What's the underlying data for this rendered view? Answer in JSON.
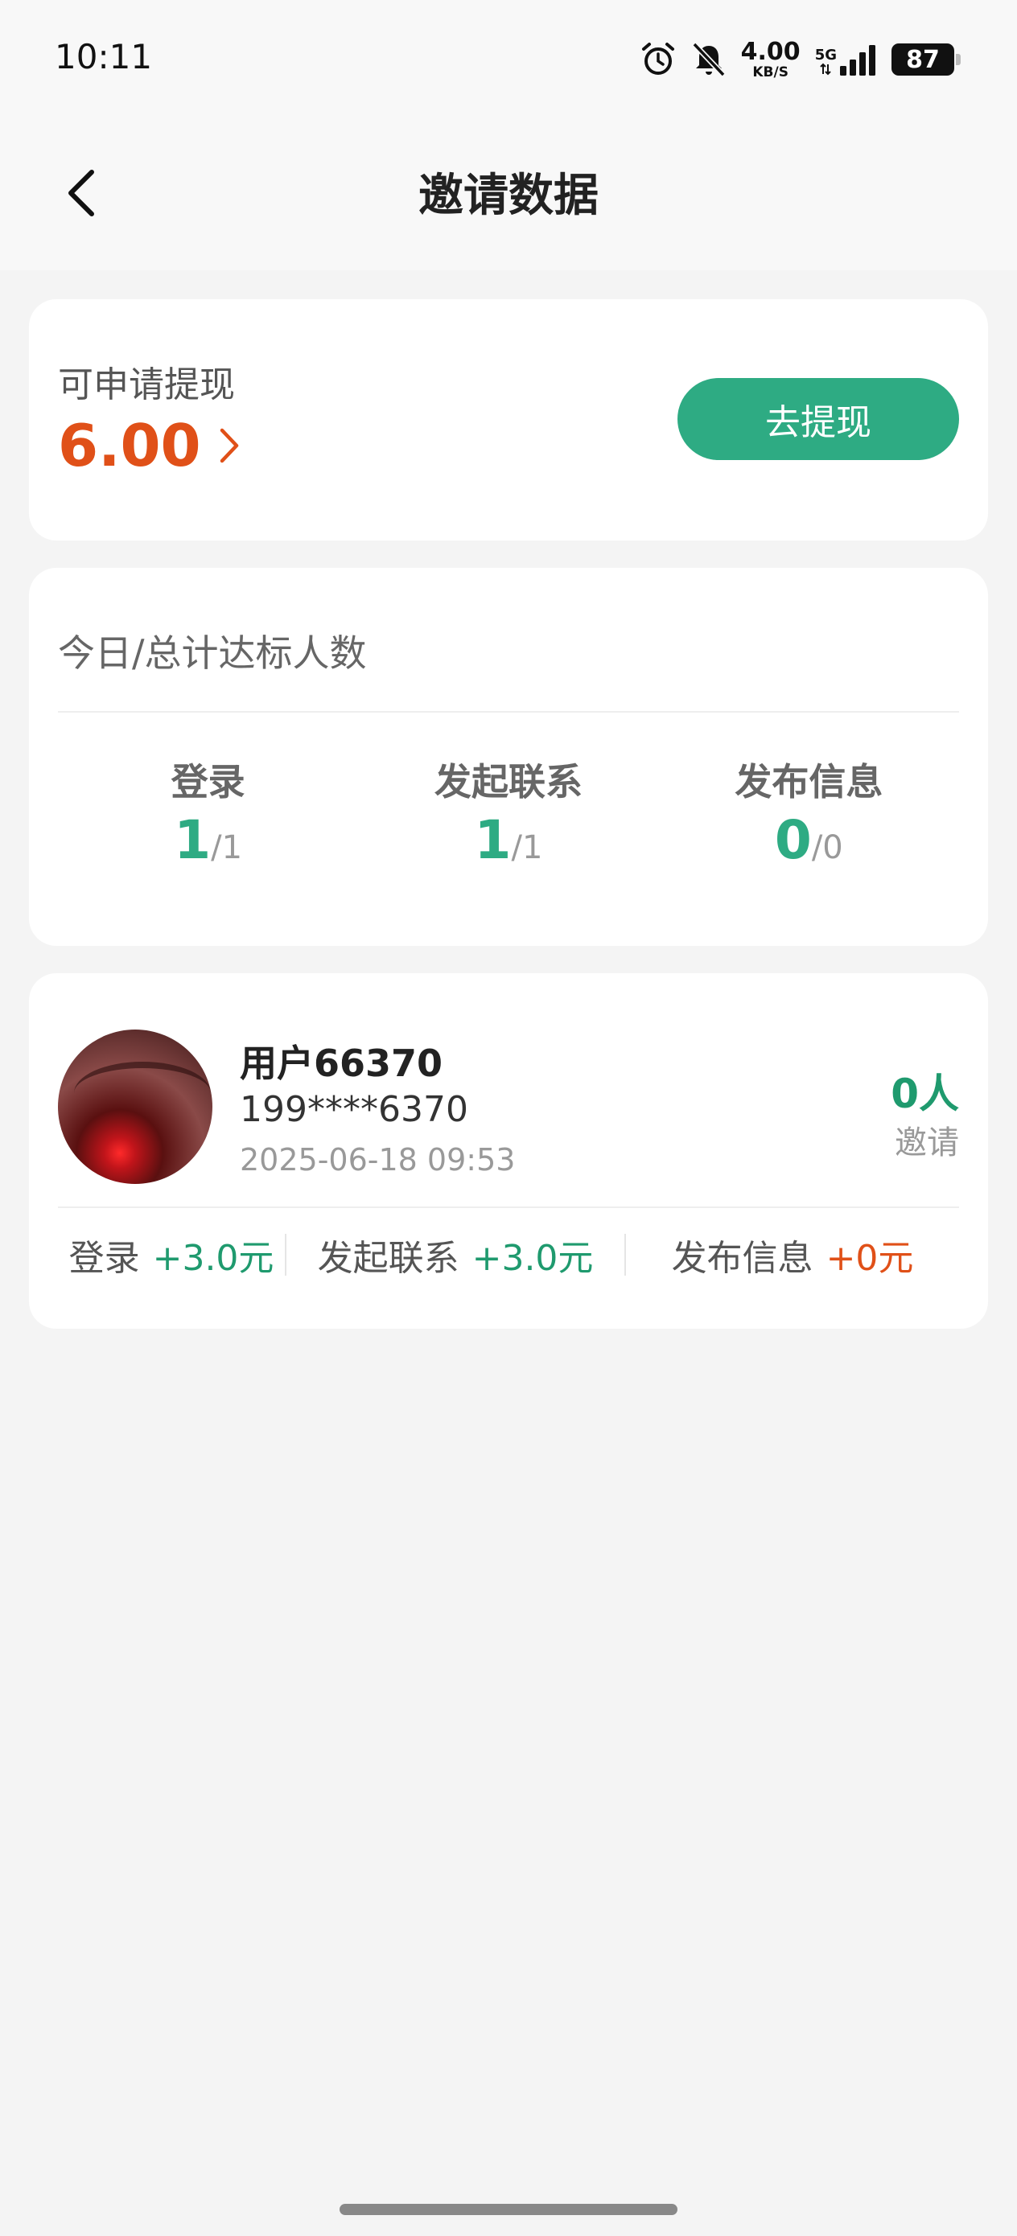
{
  "status_bar": {
    "time": "10:11",
    "net_speed_value": "4.00",
    "net_speed_unit": "KB/S",
    "network_type": "5G",
    "battery": "87"
  },
  "nav": {
    "title": "邀请数据"
  },
  "withdraw": {
    "label": "可申请提现",
    "amount": "6.00",
    "button_label": "去提现"
  },
  "stats": {
    "title": "今日/总计达标人数",
    "columns": [
      {
        "label": "登录",
        "today": "1",
        "total": "/1"
      },
      {
        "label": "发起联系",
        "today": "1",
        "total": "/1"
      },
      {
        "label": "发布信息",
        "today": "0",
        "total": "/0"
      }
    ]
  },
  "user": {
    "name": "用户66370",
    "phone": "199****6370",
    "time": "2025-06-18 09:53",
    "invite_count": "0人",
    "invite_label": "邀请",
    "rewards": [
      {
        "label": "登录",
        "value": "+3.0元"
      },
      {
        "label": "发起联系",
        "value": "+3.0元"
      },
      {
        "label": "发布信息",
        "value": "+0元"
      }
    ]
  },
  "colors": {
    "accent_green": "#2eab83",
    "accent_orange": "#e05018"
  }
}
